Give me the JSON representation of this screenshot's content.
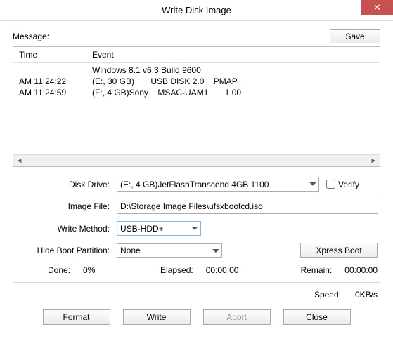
{
  "window": {
    "title": "Write Disk Image",
    "close_icon": "✕"
  },
  "message_label": "Message:",
  "save_btn": "Save",
  "log": {
    "col_time": "Time",
    "col_event": "Event",
    "rows": [
      {
        "time": "",
        "event": "Windows 8.1 v6.3 Build 9600"
      },
      {
        "time": "AM 11:24:22",
        "event": "(E:, 30 GB)       USB DISK 2.0    PMAP"
      },
      {
        "time": "AM 11:24:59",
        "event": "(F:, 4 GB)Sony    MSAC-UAM1       1.00"
      }
    ]
  },
  "form": {
    "disk_drive_label": "Disk Drive:",
    "disk_drive_value": "(E:, 4 GB)JetFlashTranscend 4GB   1100",
    "verify_label": "Verify",
    "image_file_label": "Image File:",
    "image_file_value": "D:\\Storage Image Files\\ufsxbootcd.iso",
    "write_method_label": "Write Method:",
    "write_method_value": "USB-HDD+",
    "hide_boot_label": "Hide Boot Partition:",
    "hide_boot_value": "None",
    "xpress_boot_btn": "Xpress Boot"
  },
  "status": {
    "done_label": "Done:",
    "done_value": "0%",
    "elapsed_label": "Elapsed:",
    "elapsed_value": "00:00:00",
    "remain_label": "Remain:",
    "remain_value": "00:00:00",
    "speed_label": "Speed:",
    "speed_value": "0KB/s"
  },
  "buttons": {
    "format": "Format",
    "write": "Write",
    "abort": "Abort",
    "close": "Close"
  }
}
